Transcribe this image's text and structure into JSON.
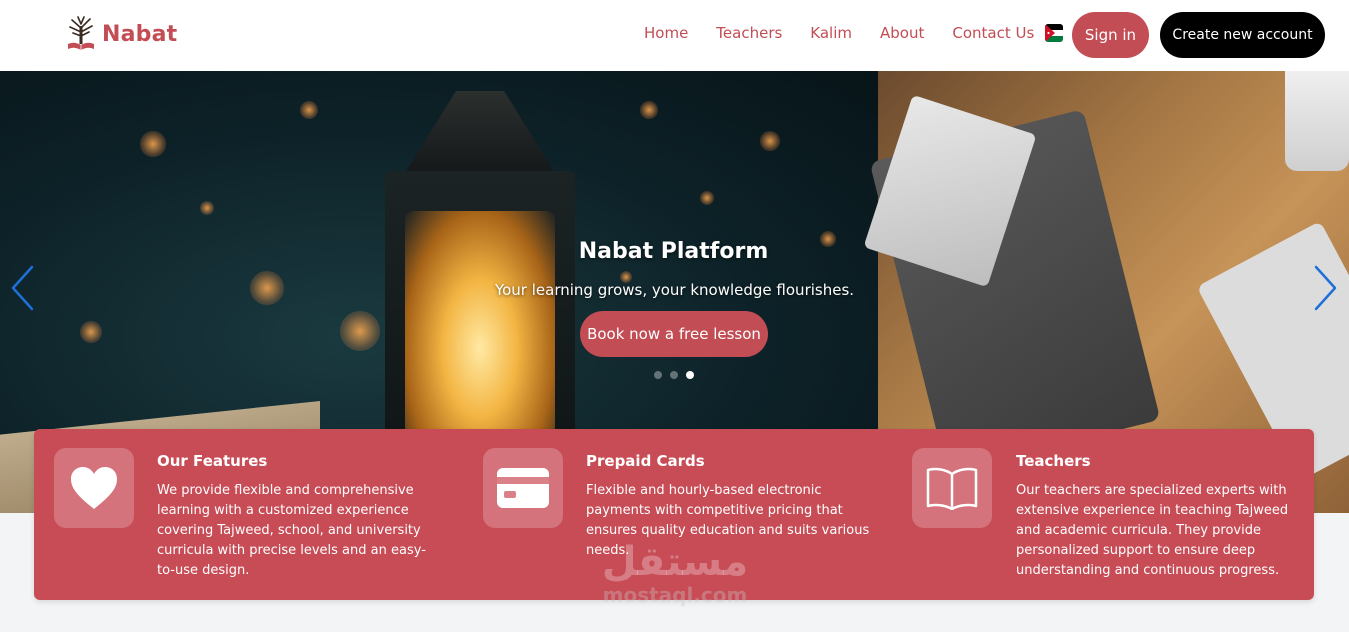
{
  "brand": {
    "name": "Nabat"
  },
  "nav": {
    "links": [
      "Home",
      "Teachers",
      "Kalim",
      "About",
      "Contact Us"
    ],
    "signin_label": "Sign in",
    "create_label": "Create new account"
  },
  "hero": {
    "title": "Nabat Platform",
    "subtitle": "Your learning grows, your knowledge flourishes.",
    "cta_label": "Book now a free lesson",
    "active_slide": 3,
    "slide_count": 3
  },
  "features": [
    {
      "title": "Our Features",
      "text": "We provide flexible and comprehensive learning with a customized experience covering Tajweed, school, and university curricula with precise levels and an easy-to-use design.",
      "icon": "heart-icon"
    },
    {
      "title": "Prepaid Cards",
      "text": "Flexible and hourly-based electronic payments with competitive pricing that ensures quality education and suits various needs.",
      "icon": "credit-card-icon"
    },
    {
      "title": "Teachers",
      "text": "Our teachers are specialized experts with extensive experience in teaching Tajweed and academic curricula. They provide personalized support to ensure deep understanding and continuous progress.",
      "icon": "open-book-icon"
    }
  ],
  "watermark": {
    "arabic": "مستقل",
    "latin": "mostaql.com"
  },
  "colors": {
    "accent": "#c24d55",
    "feature_band": "#c84c56",
    "dark_button": "#000000"
  }
}
